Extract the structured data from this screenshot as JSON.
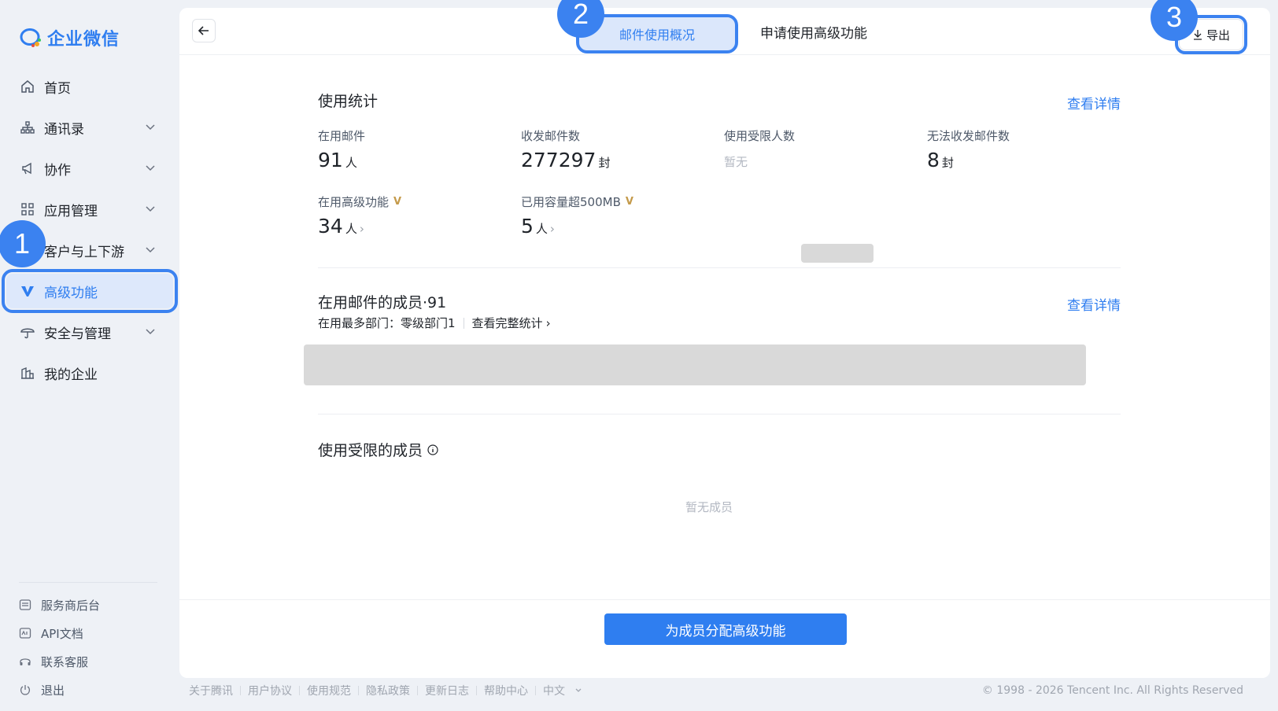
{
  "app": {
    "logo_text": "企业微信"
  },
  "sidebar": {
    "items": [
      {
        "label": "首页",
        "icon": "home-icon",
        "expandable": false
      },
      {
        "label": "通讯录",
        "icon": "org-chart-icon",
        "expandable": true
      },
      {
        "label": "协作",
        "icon": "megaphone-icon",
        "expandable": true
      },
      {
        "label": "应用管理",
        "icon": "grid-icon",
        "expandable": true
      },
      {
        "label": "客户与上下游",
        "icon": "customer-icon",
        "expandable": true
      },
      {
        "label": "高级功能",
        "icon": "vip-icon",
        "expandable": false,
        "active": true
      },
      {
        "label": "安全与管理",
        "icon": "umbrella-icon",
        "expandable": true
      },
      {
        "label": "我的企业",
        "icon": "building-icon",
        "expandable": false
      }
    ],
    "bottom": [
      {
        "label": "服务商后台",
        "icon": "console-icon"
      },
      {
        "label": "API文档",
        "icon": "api-icon"
      },
      {
        "label": "联系客服",
        "icon": "headset-icon"
      },
      {
        "label": "退出",
        "icon": "power-icon"
      }
    ]
  },
  "badges": {
    "b1": "1",
    "b2": "2",
    "b3": "3"
  },
  "header": {
    "tab_overview": "邮件使用概况",
    "tab_apply": "申请使用高级功能",
    "export": "导出"
  },
  "usage": {
    "title": "使用统计",
    "detail_link": "查看详情",
    "stats": {
      "active_mail": {
        "label": "在用邮件",
        "value": "91",
        "unit": "人"
      },
      "sent_received": {
        "label": "收发邮件数",
        "value": "277297",
        "unit": "封"
      },
      "restricted": {
        "label": "使用受限人数",
        "empty": "暂无"
      },
      "failed": {
        "label": "无法收发邮件数",
        "value": "8",
        "unit": "封"
      },
      "advanced": {
        "label": "在用高级功能",
        "value": "34",
        "unit": "人"
      },
      "over_500mb": {
        "label": "已用容量超500MB",
        "value": "5",
        "unit": "人"
      }
    }
  },
  "members": {
    "title": "在用邮件的成员·91",
    "detail_link": "查看详情",
    "top_dept": "在用最多部门：零级部门1",
    "full_stats": "查看完整统计"
  },
  "restricted_members": {
    "title": "使用受限的成员",
    "empty": "暂无成员"
  },
  "footer": {
    "assign_button": "为成员分配高级功能",
    "links": [
      "关于腾讯",
      "用户协议",
      "使用规范",
      "隐私政策",
      "更新日志",
      "帮助中心"
    ],
    "language": "中文",
    "copyright": "© 1998 - 2026 Tencent Inc. All Rights Reserved"
  },
  "colors": {
    "accent": "#2f7ef0",
    "highlight": "#3b82f0"
  }
}
